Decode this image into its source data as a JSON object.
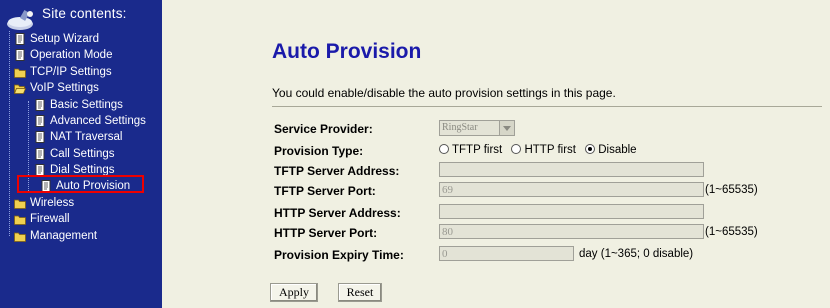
{
  "sidebar": {
    "title": "Site contents:",
    "items": [
      {
        "label": "Setup Wizard"
      },
      {
        "label": "Operation Mode"
      },
      {
        "label": "TCP/IP Settings"
      },
      {
        "label": "VoIP Settings"
      },
      {
        "label": "Basic Settings"
      },
      {
        "label": "Advanced Settings"
      },
      {
        "label": "NAT Traversal"
      },
      {
        "label": "Call Settings"
      },
      {
        "label": "Dial Settings"
      },
      {
        "label": "Auto Provision"
      },
      {
        "label": "Wireless"
      },
      {
        "label": "Firewall"
      },
      {
        "label": "Management"
      }
    ]
  },
  "main": {
    "title": "Auto Provision",
    "description": "You could enable/disable the auto provision settings in this page.",
    "fields": {
      "service_provider": {
        "label": "Service Provider:",
        "value": "RingStar"
      },
      "provision_type": {
        "label": "Provision Type:",
        "options": [
          "TFTP first",
          "HTTP first",
          "Disable"
        ],
        "selected": "Disable"
      },
      "tftp_address": {
        "label": "TFTP Server Address:",
        "value": ""
      },
      "tftp_port": {
        "label": "TFTP Server Port:",
        "value": "69",
        "suffix": "(1~65535)"
      },
      "http_address": {
        "label": "HTTP Server Address:",
        "value": ""
      },
      "http_port": {
        "label": "HTTP Server Port:",
        "value": "80",
        "suffix": "(1~65535)"
      },
      "expiry": {
        "label": "Provision Expiry Time:",
        "value": "0",
        "suffix": "day (1~365; 0 disable)"
      }
    },
    "buttons": {
      "apply": "Apply",
      "reset": "Reset"
    }
  },
  "colors": {
    "sidebar_bg": "#1a2a8c",
    "title": "#1a1aaa",
    "highlight": "#e00000",
    "page_bg": "#f0f0e2"
  }
}
